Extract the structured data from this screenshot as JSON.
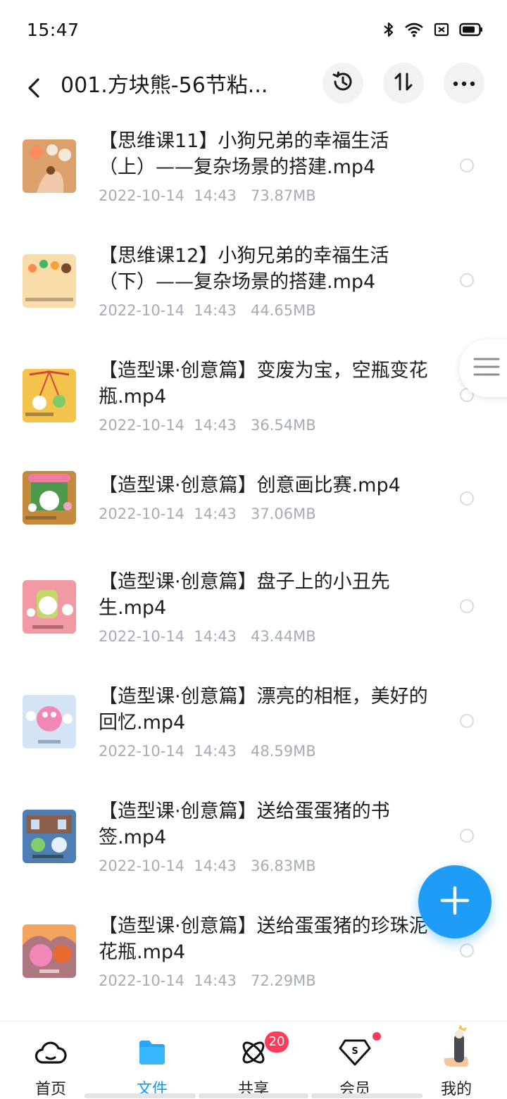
{
  "status_bar": {
    "time": "15:47",
    "icons": [
      "bluetooth-icon",
      "wifi-icon",
      "sim-off-icon",
      "battery-icon"
    ]
  },
  "header": {
    "title": "001.方块熊-56节粘...",
    "actions": [
      "history-icon",
      "sort-icon",
      "more-icon"
    ]
  },
  "files": [
    {
      "name": "【思维课11】小狗兄弟的幸福生活（上）——复杂场景的搭建.mp4",
      "date": "2022-10-14  14:43",
      "size": "73.87MB",
      "thumb_color": "#e0a06a"
    },
    {
      "name": "【思维课12】小狗兄弟的幸福生活（下）——复杂场景的搭建.mp4",
      "date": "2022-10-14  14:43",
      "size": "44.65MB",
      "thumb_color": "#f6d7a2"
    },
    {
      "name": "【造型课·创意篇】变废为宝，空瓶变花瓶.mp4",
      "date": "2022-10-14  14:43",
      "size": "36.54MB",
      "thumb_color": "#f2c04a"
    },
    {
      "name": "【造型课·创意篇】创意画比赛.mp4",
      "date": "2022-10-14  14:43",
      "size": "37.06MB",
      "thumb_color": "#c98a3e"
    },
    {
      "name": "【造型课·创意篇】盘子上的小丑先生.mp4",
      "date": "2022-10-14  14:43",
      "size": "43.44MB",
      "thumb_color": "#f09aa4"
    },
    {
      "name": "【造型课·创意篇】漂亮的相框，美好的回忆.mp4",
      "date": "2022-10-14  14:43",
      "size": "48.59MB",
      "thumb_color": "#c9dcf2"
    },
    {
      "name": "【造型课·创意篇】送给蛋蛋猪的书签.mp4",
      "date": "2022-10-14  14:43",
      "size": "36.83MB",
      "thumb_color": "#4e7fb5"
    },
    {
      "name": "【造型课·创意篇】送给蛋蛋猪的珍珠泥花瓶.mp4",
      "date": "2022-10-14  14:43",
      "size": "72.29MB",
      "thumb_color": "#e88a55"
    }
  ],
  "fab": {
    "icon": "plus-icon",
    "color": "#1f9cf5"
  },
  "bottom_nav": {
    "items": [
      {
        "label": "首页",
        "icon": "cloud-home-icon"
      },
      {
        "label": "文件",
        "icon": "folder-icon"
      },
      {
        "label": "共享",
        "icon": "share-orbit-icon"
      },
      {
        "label": "会员",
        "icon": "vip-diamond-icon"
      },
      {
        "label": "我的",
        "icon": "avatar"
      }
    ],
    "active_index": 1,
    "share_badge": "20",
    "accent_color": "#1b95f0"
  }
}
